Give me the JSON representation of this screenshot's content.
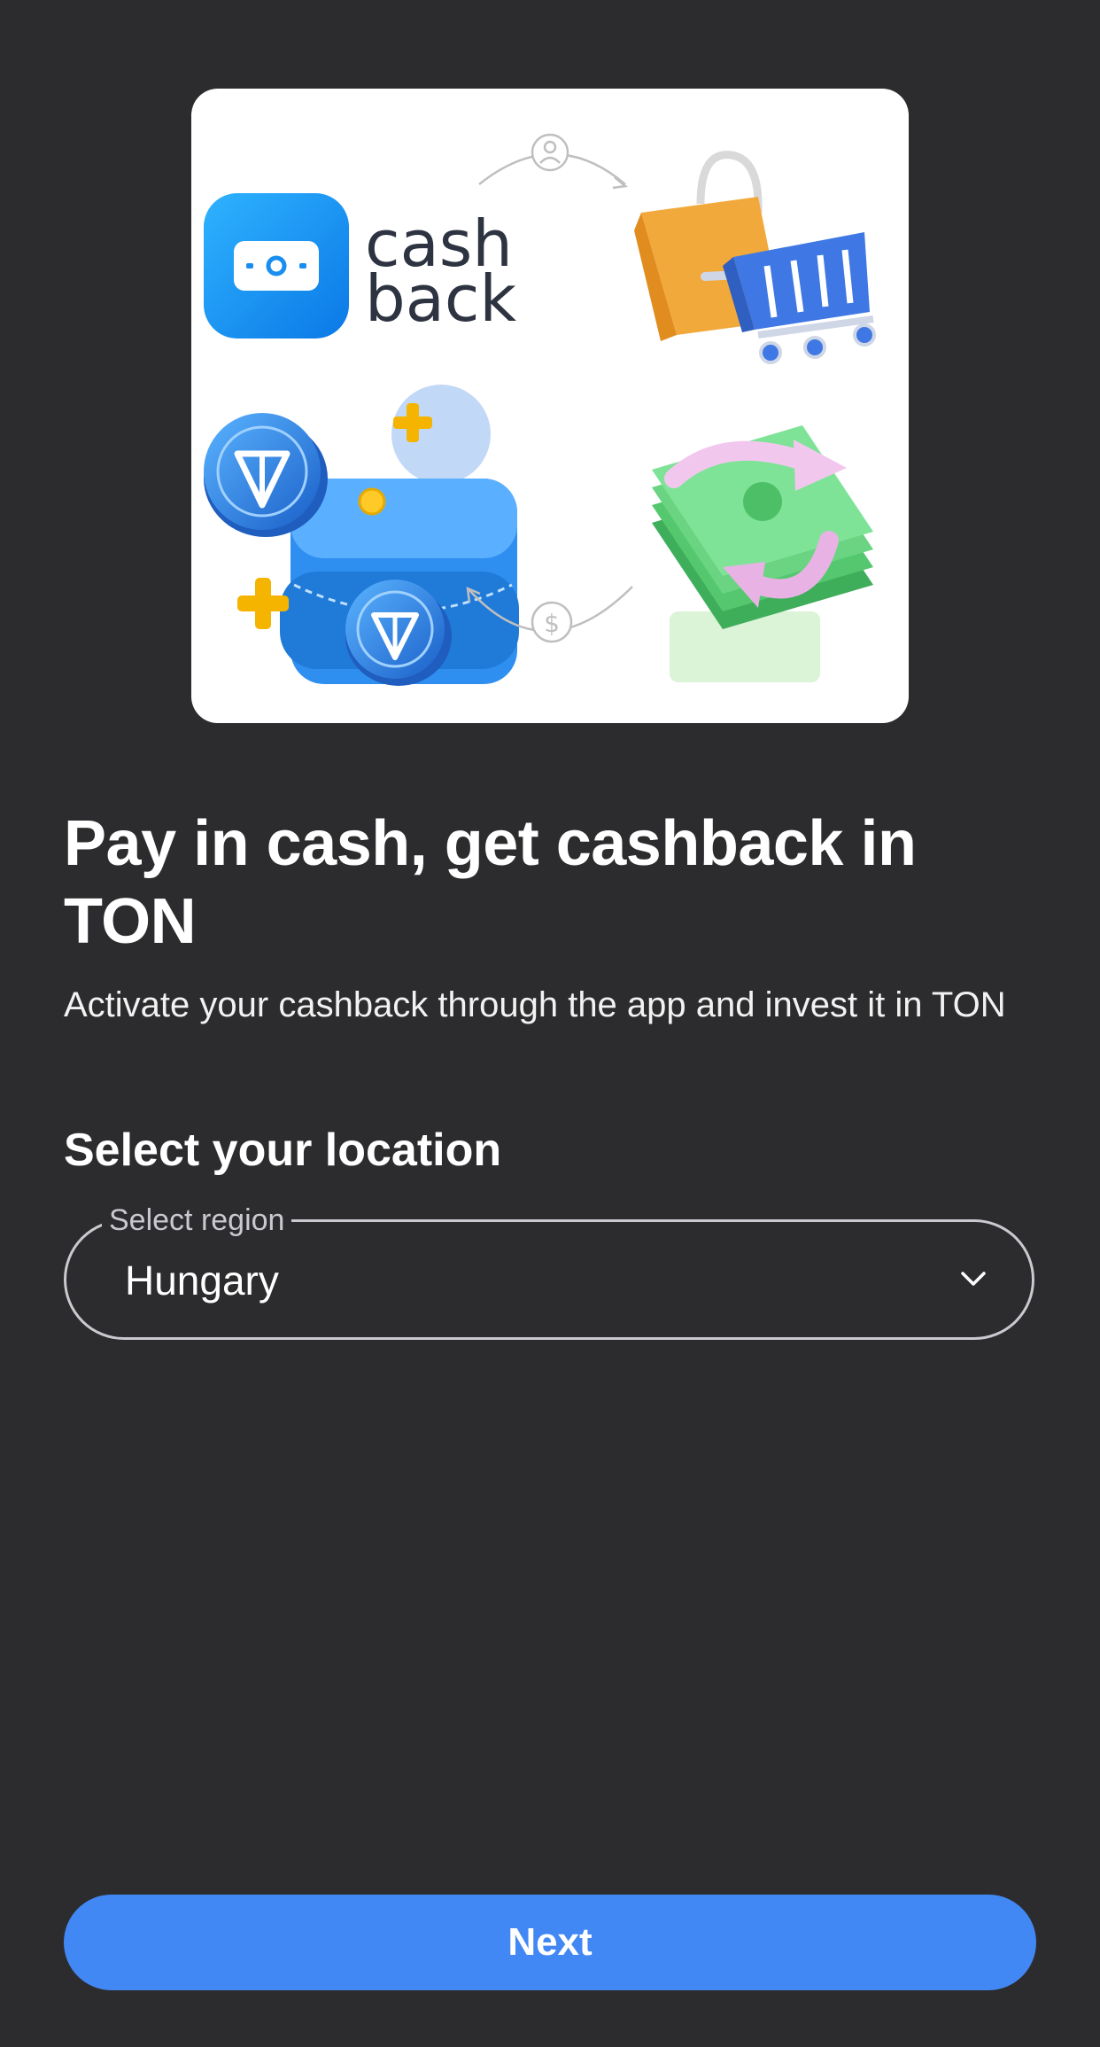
{
  "hero": {
    "logo_text_line1": "cash",
    "logo_text_line2": "back",
    "icons": [
      "cashback-logo-icon",
      "user-icon",
      "shopping-bag-icon",
      "shopping-cart-icon",
      "ton-coin-icon",
      "wallet-icon",
      "plus-icon",
      "dollar-icon",
      "money-stack-icon",
      "refresh-arrow-icon"
    ]
  },
  "headline": "Pay in cash, get cashback in TON",
  "subtext": "Activate your cashback through the app and invest it in TON",
  "location": {
    "title": "Select your location",
    "region_label": "Select region",
    "region_value": "Hungary"
  },
  "actions": {
    "next_label": "Next"
  },
  "colors": {
    "background": "#2c2c2e",
    "accent": "#4288f4"
  }
}
